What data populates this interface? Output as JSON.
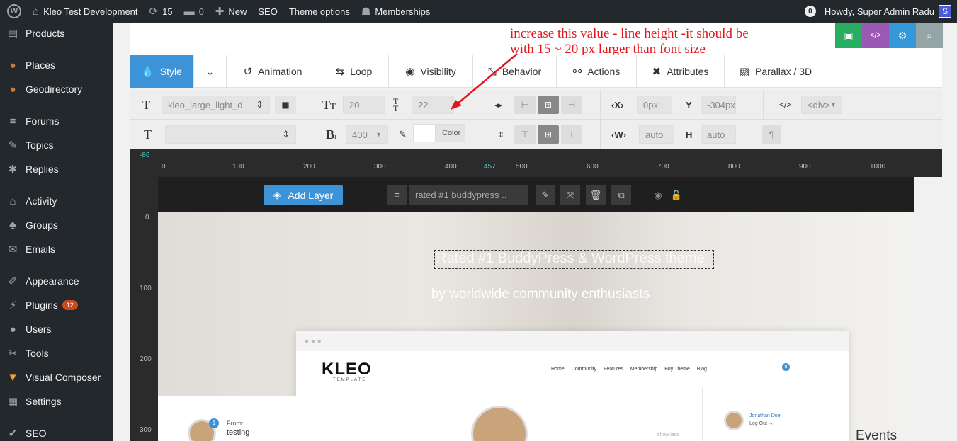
{
  "adminbar": {
    "site_name": "Kleo Test Development",
    "updates_count": "15",
    "comments_count": "0",
    "new_label": "New",
    "seo_label": "SEO",
    "theme_options_label": "Theme options",
    "memberships_label": "Memberships",
    "notif_count": "0",
    "howdy": "Howdy, Super Admin Radu",
    "avatar_letter": "S"
  },
  "sidebar": {
    "items": [
      {
        "label": "Products",
        "icon": "products-icon"
      },
      {
        "label": "Places",
        "icon": "places-icon"
      },
      {
        "label": "Geodirectory",
        "icon": "geodirectory-icon"
      },
      {
        "label": "Forums",
        "icon": "forums-icon"
      },
      {
        "label": "Topics",
        "icon": "topics-icon"
      },
      {
        "label": "Replies",
        "icon": "replies-icon"
      },
      {
        "label": "Activity",
        "icon": "activity-icon"
      },
      {
        "label": "Groups",
        "icon": "groups-icon"
      },
      {
        "label": "Emails",
        "icon": "emails-icon"
      },
      {
        "label": "Appearance",
        "icon": "appearance-icon"
      },
      {
        "label": "Plugins",
        "icon": "plugins-icon",
        "badge": "12"
      },
      {
        "label": "Users",
        "icon": "users-icon"
      },
      {
        "label": "Tools",
        "icon": "tools-icon"
      },
      {
        "label": "Visual Composer",
        "icon": "visual-composer-icon"
      },
      {
        "label": "Settings",
        "icon": "settings-icon"
      },
      {
        "label": "SEO",
        "icon": "seo-icon"
      }
    ]
  },
  "annotation": {
    "line1": "increase this value - line height -it should be",
    "line2": "with 15 ~ 20 px larger than font size"
  },
  "tabs": {
    "style": "Style",
    "animation": "Animation",
    "loop": "Loop",
    "visibility": "Visibility",
    "behavior": "Behavior",
    "actions": "Actions",
    "attributes": "Attributes",
    "parallax": "Parallax / 3D"
  },
  "style_row": {
    "font_style_value": "kleo_large_light_d",
    "font_size": "20",
    "line_height": "22",
    "x_value": "0px",
    "y_value": "-304px",
    "tag_value": "<div>",
    "font_weight": "400",
    "color_label": "Color",
    "width_value": "auto",
    "height_value": "auto",
    "x_label": "X",
    "y_label": "Y",
    "w_label": "W",
    "h_label": "H"
  },
  "ruler": {
    "top_marks": [
      "0",
      "100",
      "200",
      "300",
      "400",
      "457",
      "500",
      "600",
      "700",
      "800",
      "900",
      "1000"
    ],
    "left_marks": [
      "0",
      "100",
      "200",
      "300"
    ],
    "offset_label": "-86"
  },
  "canvas_toolbar": {
    "add_layer": "Add Layer",
    "layer_name": "rated #1 buddypress .."
  },
  "slide": {
    "headline": "Rated #1 BuddyPress & WordPress theme",
    "subline": "by worldwide community enthusiasts",
    "logo": "KLEO",
    "logo_sub": "TEMPLATE",
    "nav": [
      "Home",
      "Community",
      "Features",
      "Membership",
      "Buy Theme",
      "Blog"
    ],
    "cart_count": "9",
    "profile_name": "Jonathan Doe",
    "profile_logout": "Log Out →",
    "show_less": "show less",
    "from_label": "From:",
    "from_value": "testing",
    "from_badge": "1",
    "events": "Events"
  },
  "colors": {
    "adminbar_bg": "#23282d",
    "accent_blue": "#3d93d8",
    "save_green": "#27ae60",
    "code_purple": "#9b59b6",
    "settings_blue": "#3498db",
    "search_gray": "#95a5a6",
    "annotation_red": "#e4141b"
  }
}
